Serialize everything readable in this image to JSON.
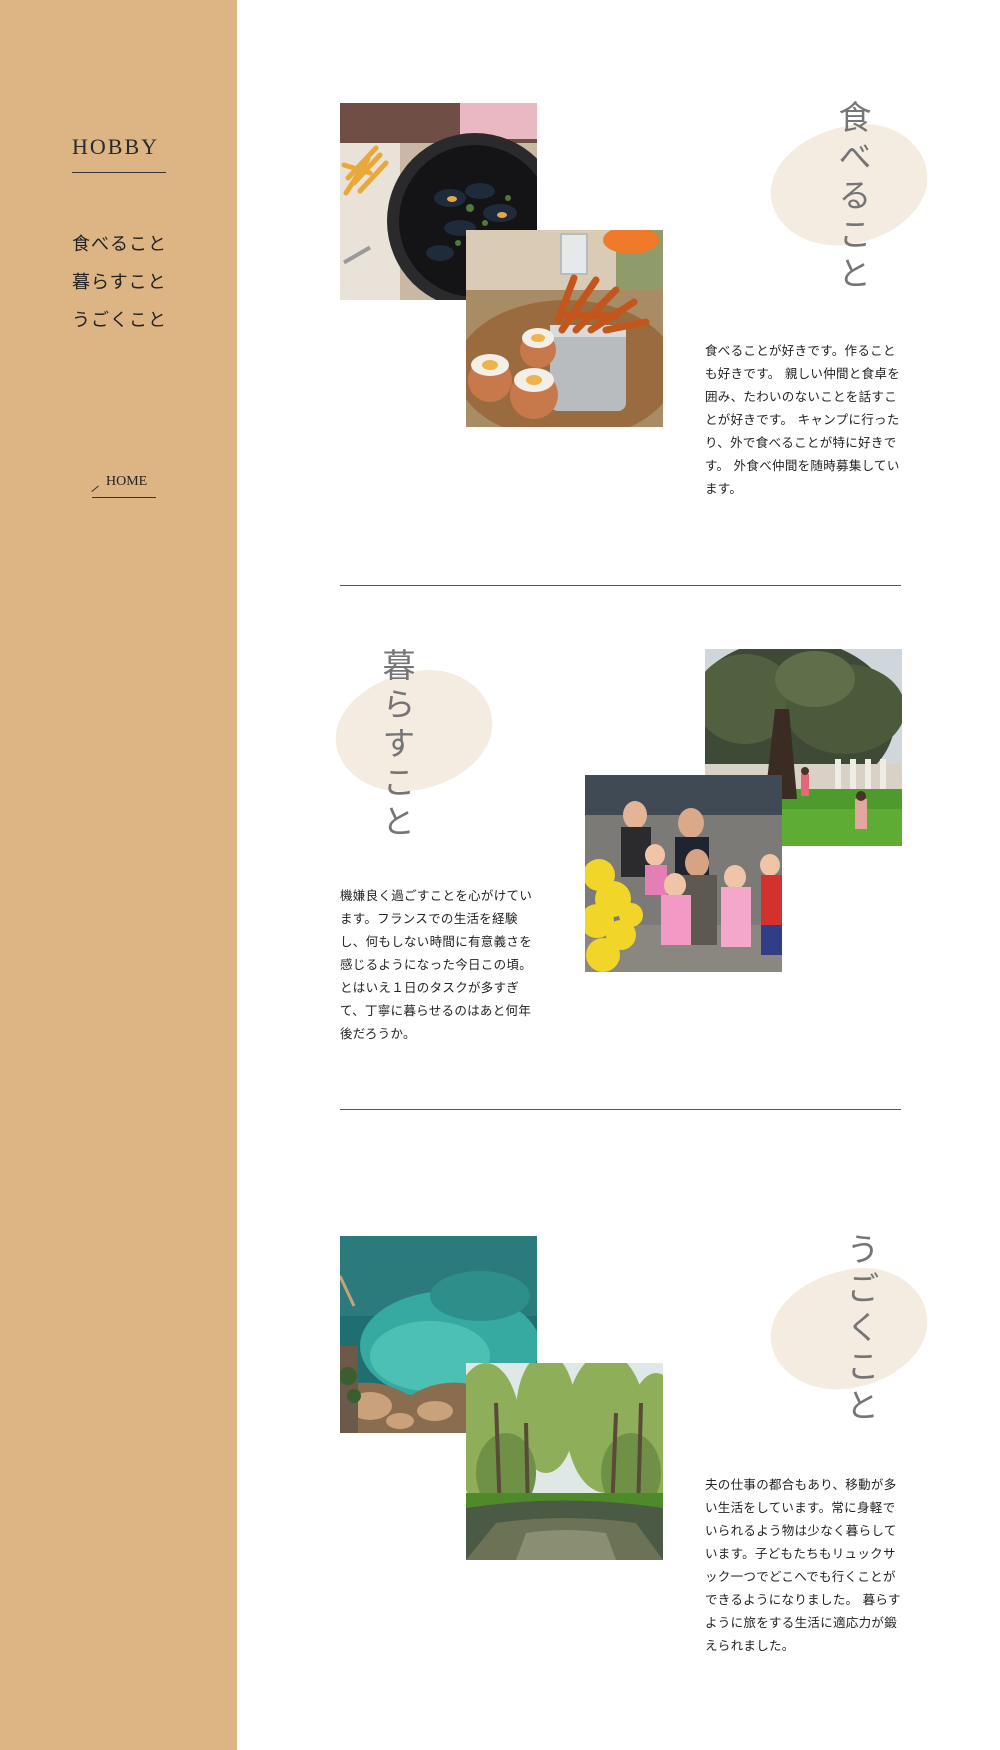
{
  "sidebar": {
    "title": "HOBBY",
    "nav": [
      "食べること",
      "暮らすこと",
      "うごくこと"
    ],
    "home_label": "HOME",
    "background_color": "#ddb585"
  },
  "sections": [
    {
      "title": "食べること",
      "text": "食べることが好きです。作ることも好きです。 親しい仲間と食卓を囲み、たわいのないことを話すことが好きです。 キャンプに行ったり、外で食べることが特に好きです。 外食べ仲間を随時募集しています。",
      "photos": [
        "mussels-and-fries-photo",
        "sweet-potato-fries-and-eggs-photo"
      ]
    },
    {
      "title": "暮らすこと",
      "text": "機嫌良く過ごすことを心がけています。フランスでの生活を経験し、何もしない時間に有意義さを感じるようになった今日この頃。 とはいえ１日のタスクが多すぎて、丁寧に暮らせるのはあと何年後だろうか。",
      "photos": [
        "park-tree-photo",
        "family-group-photo"
      ]
    },
    {
      "title": "うごくこと",
      "text": "夫の仕事の都合もあり、移動が多い生活をしています。常に身軽でいられるよう物は少なく暮らしています。子どもたちもリュックサック一つでどこへでも行くことができるようになりました。 暮らすように旅をする生活に適応力が鍛えられました。",
      "photos": [
        "turquoise-sea-coast-photo",
        "tree-lined-river-photo"
      ]
    }
  ],
  "colors": {
    "blob": "#f4ebe1",
    "heading": "#757575",
    "divider": "#555555"
  }
}
